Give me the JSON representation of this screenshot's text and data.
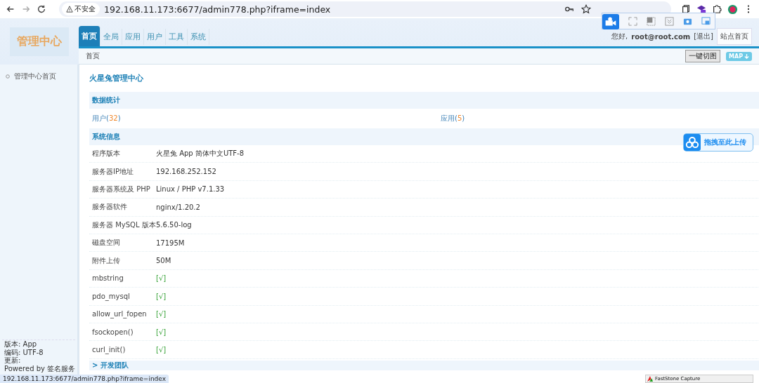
{
  "browser": {
    "security_label": "不安全",
    "url": "192.168.11.173:6677/admin778.php?iframe=index"
  },
  "header": {
    "logo": "管理中心",
    "nav_tabs": [
      {
        "label": "首页",
        "selected": true
      },
      {
        "label": "全局",
        "selected": false
      },
      {
        "label": "应用",
        "selected": false
      },
      {
        "label": "用户",
        "selected": false
      },
      {
        "label": "工具",
        "selected": false
      },
      {
        "label": "系统",
        "selected": false
      }
    ],
    "greeting": "您好,",
    "user": "root@root.com",
    "logout": "[退出]",
    "site_home": "站点首页"
  },
  "breadcrumb": {
    "text": "首页",
    "cut_button": "一键切图",
    "map_button": "MAP"
  },
  "sidebar": {
    "items": [
      {
        "label": "管理中心首页"
      }
    ],
    "footer": [
      "版本: App",
      "编码: UTF-8",
      "更新:",
      "Powered by 签名服务"
    ]
  },
  "content": {
    "title": "火星兔管理中心",
    "stats": {
      "title": "数据统计",
      "items": [
        {
          "label": "用户(",
          "count": "32",
          "close": ")"
        },
        {
          "label": "应用(",
          "count": "5",
          "close": ")"
        }
      ]
    },
    "sysinfo": {
      "title": "系统信息",
      "rows": [
        {
          "label": "程序版本",
          "value": "火星兔 App 简体中文UTF-8",
          "kind": "text"
        },
        {
          "label": "服务器IP地址",
          "value": "192.168.252.152",
          "kind": "text"
        },
        {
          "label": "服务器系统及 PHP",
          "value": "Linux / PHP v7.1.33",
          "kind": "text"
        },
        {
          "label": "服务器软件",
          "value": "nginx/1.20.2",
          "kind": "text"
        },
        {
          "label": "服务器 MySQL 版本",
          "value": "5.6.50-log",
          "kind": "text"
        },
        {
          "label": "磁盘空间",
          "value": "17195M",
          "kind": "text"
        },
        {
          "label": "附件上传",
          "value": "50M",
          "kind": "text"
        },
        {
          "label": "mbstring",
          "value": "[√]",
          "kind": "check"
        },
        {
          "label": "pdo_mysql",
          "value": "[√]",
          "kind": "check"
        },
        {
          "label": "allow_url_fopen",
          "value": "[√]",
          "kind": "check"
        },
        {
          "label": "fsockopen()",
          "value": "[√]",
          "kind": "check"
        },
        {
          "label": "curl_init()",
          "value": "[√]",
          "kind": "check"
        }
      ]
    },
    "next_section": "> 开发团队"
  },
  "status_url": "192.168.11.173:6677/admin778.php?iframe=index",
  "upload_widget": "拖拽至此上传",
  "capture_taskbar": "FastStone Capture"
}
